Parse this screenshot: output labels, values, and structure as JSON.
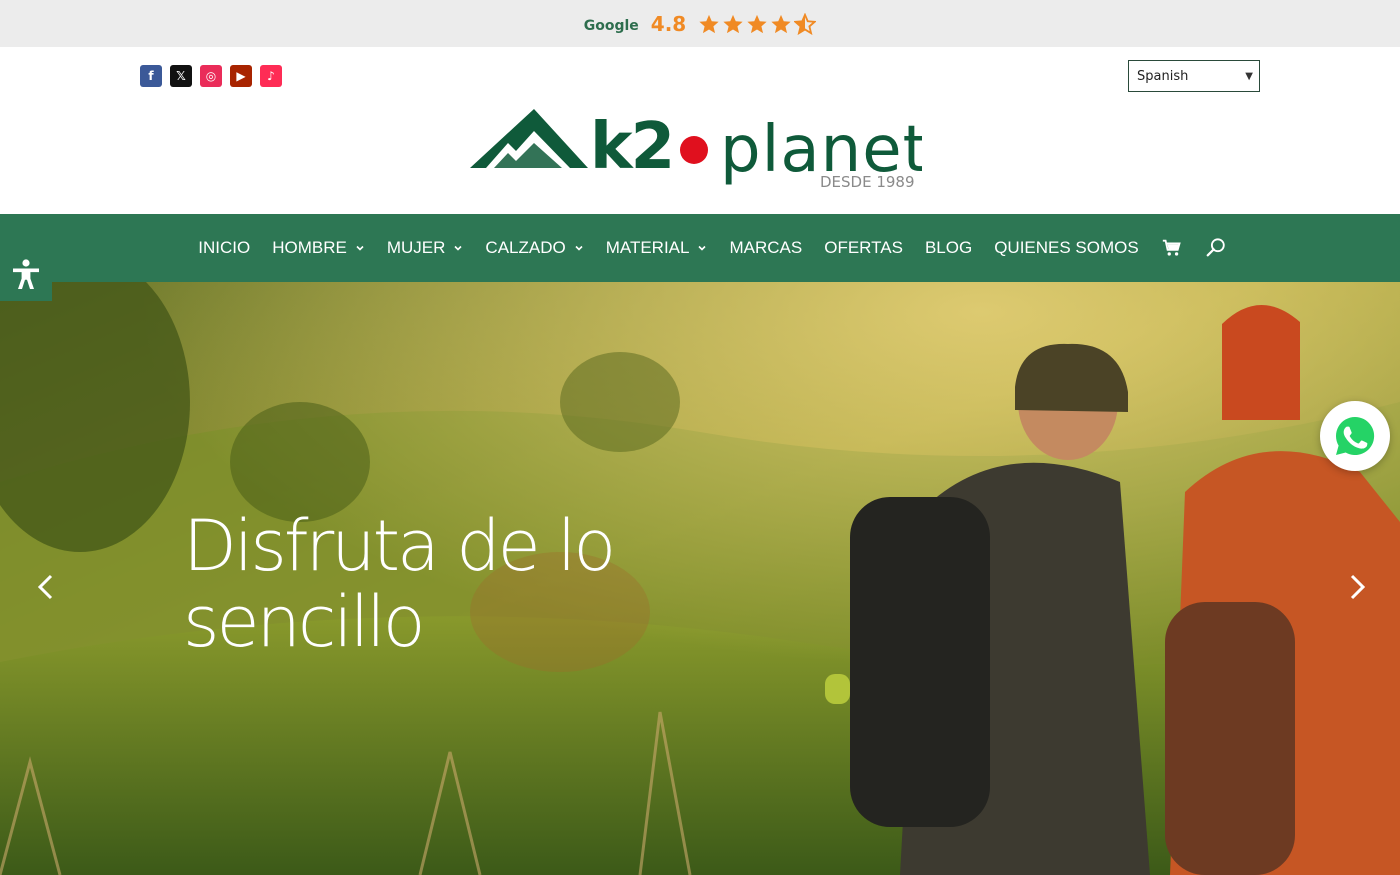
{
  "rating": {
    "source": "Google",
    "value": "4.8",
    "stars": 4.5,
    "star_color": "#f08a24"
  },
  "social": {
    "facebook": "f",
    "x": "𝕏",
    "instagram": "◎",
    "youtube": "▶",
    "tiktok": "♪"
  },
  "language": {
    "selected": "Spanish"
  },
  "logo": {
    "brand_k2": "k2",
    "brand_planet": "planet",
    "tagline": "DESDE 1989",
    "brand_color": "#0f5a3a",
    "dot_color": "#e0101e"
  },
  "nav": {
    "color": "#2d7754",
    "items": [
      {
        "label": "INICIO",
        "dropdown": false
      },
      {
        "label": "HOMBRE",
        "dropdown": true
      },
      {
        "label": "MUJER",
        "dropdown": true
      },
      {
        "label": "CALZADO",
        "dropdown": true
      },
      {
        "label": "MATERIAL",
        "dropdown": true
      },
      {
        "label": "MARCAS",
        "dropdown": false
      },
      {
        "label": "OFERTAS",
        "dropdown": false
      },
      {
        "label": "BLOG",
        "dropdown": false
      },
      {
        "label": "QUIENES SOMOS",
        "dropdown": false
      }
    ],
    "icons": [
      "cart-icon",
      "search-icon"
    ]
  },
  "hero": {
    "title_line1": "Disfruta de lo",
    "title_line2": "sencillo"
  }
}
